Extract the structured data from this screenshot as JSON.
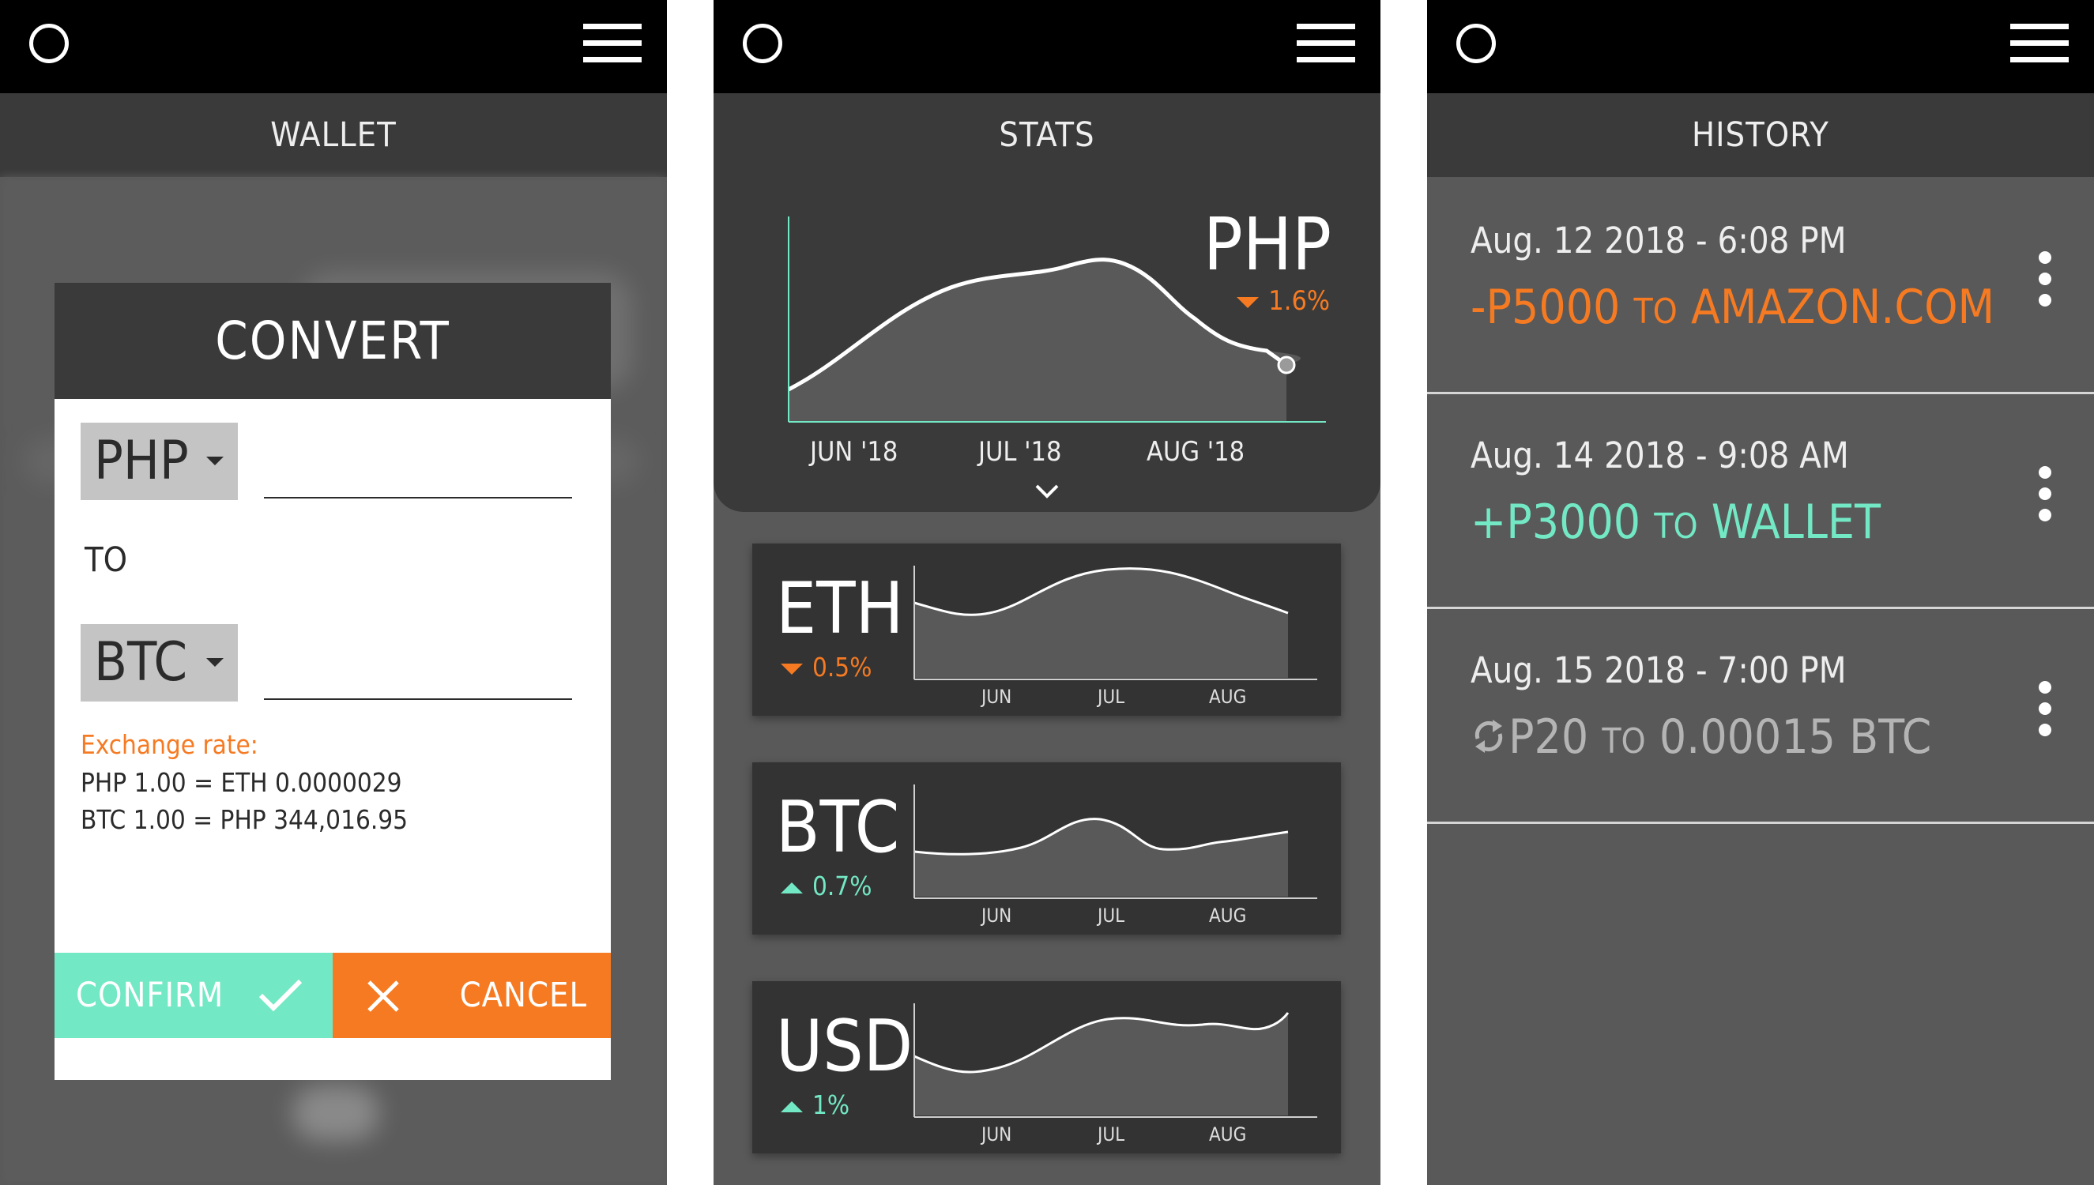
{
  "colors": {
    "accent_orange": "#f57a22",
    "accent_green": "#73e8c4",
    "header_black": "#000000",
    "panel_dark": "#3a3a3a",
    "bg_gray": "#595959"
  },
  "wallet": {
    "title": "WALLET",
    "convert": {
      "title": "CONVERT",
      "from_currency": "PHP",
      "to_label": "TO",
      "to_currency": "BTC",
      "rate_label": "Exchange rate:",
      "rate_line_1": "PHP 1.00 = ETH 0.0000029",
      "rate_line_2": "BTC 1.00 = PHP 344,016.95",
      "confirm_label": "CONFIRM",
      "cancel_label": "CANCEL"
    }
  },
  "stats": {
    "title": "STATS",
    "main": {
      "currency": "PHP",
      "change": "1.6%",
      "direction": "down",
      "months": [
        "JUN '18",
        "JUL '18",
        "AUG '18"
      ]
    },
    "cards": [
      {
        "currency": "ETH",
        "change": "0.5%",
        "direction": "down",
        "months": [
          "JUN",
          "JUL",
          "AUG"
        ]
      },
      {
        "currency": "BTC",
        "change": "0.7%",
        "direction": "up",
        "months": [
          "JUN",
          "JUL",
          "AUG"
        ]
      },
      {
        "currency": "USD",
        "change": "1%",
        "direction": "up",
        "months": [
          "JUN",
          "JUL",
          "AUG"
        ]
      }
    ]
  },
  "history": {
    "title": "HISTORY",
    "items": [
      {
        "date": "Aug. 12 2018 - 6:08 PM",
        "amount": "-P5000",
        "to_word": "TO",
        "target": "AMAZON.COM",
        "color": "#f57a22"
      },
      {
        "date": "Aug. 14 2018 - 9:08 AM",
        "amount": "+P3000",
        "to_word": "TO",
        "target": "WALLET",
        "color": "#73e8c4"
      },
      {
        "date": "Aug. 15 2018 - 7:00 PM",
        "amount": "P20",
        "to_word": "TO",
        "target": "0.00015 BTC",
        "color": "#b4b4b4",
        "icon": "refresh-icon"
      }
    ]
  }
}
